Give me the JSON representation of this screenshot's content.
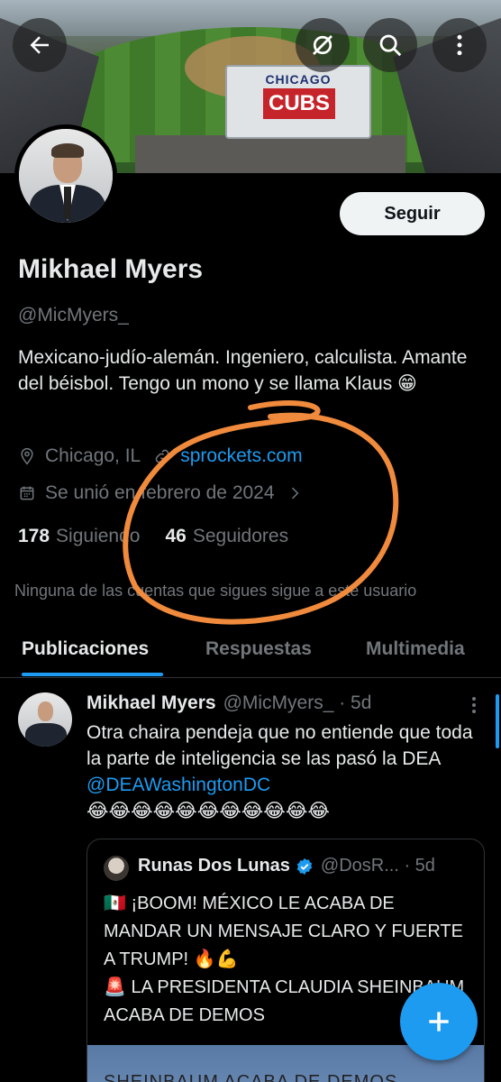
{
  "header": {
    "back_icon": "arrow-left-icon",
    "grok_icon": "grok-icon",
    "search_icon": "search-icon",
    "more_icon": "more-vertical-icon"
  },
  "banner": {
    "board_title": "CHICAGO",
    "board_logo": "CUBS"
  },
  "profile": {
    "follow_label": "Seguir",
    "name": "Mikhael Myers",
    "handle": "@MicMyers_",
    "bio": "Mexicano-judío-alemán. Ingeniero, calculista. Amante del béisbol. Tengo un mono y se llama Klaus 😁",
    "location": "Chicago, IL",
    "website": "sprockets.com",
    "joined": "Se unió en febrero de 2024",
    "following_count": "178",
    "following_label": "Siguiendo",
    "followers_count": "46",
    "followers_label": "Seguidores",
    "followers_note": "Ninguna de las cuentas que sigues sigue a este usuario"
  },
  "tabs": [
    {
      "label": "Publicaciones",
      "active": true
    },
    {
      "label": "Respuestas",
      "active": false
    },
    {
      "label": "Multimedia",
      "active": false
    }
  ],
  "post": {
    "author": "Mikhael Myers",
    "meta": "@MicMyers_ · 5d",
    "text_before": "Otra chaira pendeja que no entiende que toda la parte de inteligencia se las pasó la DEA ",
    "mention": "@DEAWashingtonDC",
    "emojis": "😂😂😂😂😂😂😂😂😂😂😂",
    "quote": {
      "author": "Runas Dos Lunas",
      "meta": "@DosR... · 5d",
      "line1": "🇲🇽 ¡BOOM! MÉXICO LE ACABA DE MANDAR UN MENSAJE CLARO Y FUERTE A TRUMP! 🔥💪",
      "line2": "🚨 LA PRESIDENTA CLAUDIA SHEINBAUM ACABA DE DEMOS",
      "media_text": "SHEINBAUM ACABA DE DEMOS"
    }
  },
  "fab": {
    "icon": "plus-icon"
  },
  "colors": {
    "accent": "#1d9bf0",
    "annotation": "#f08a3c"
  }
}
